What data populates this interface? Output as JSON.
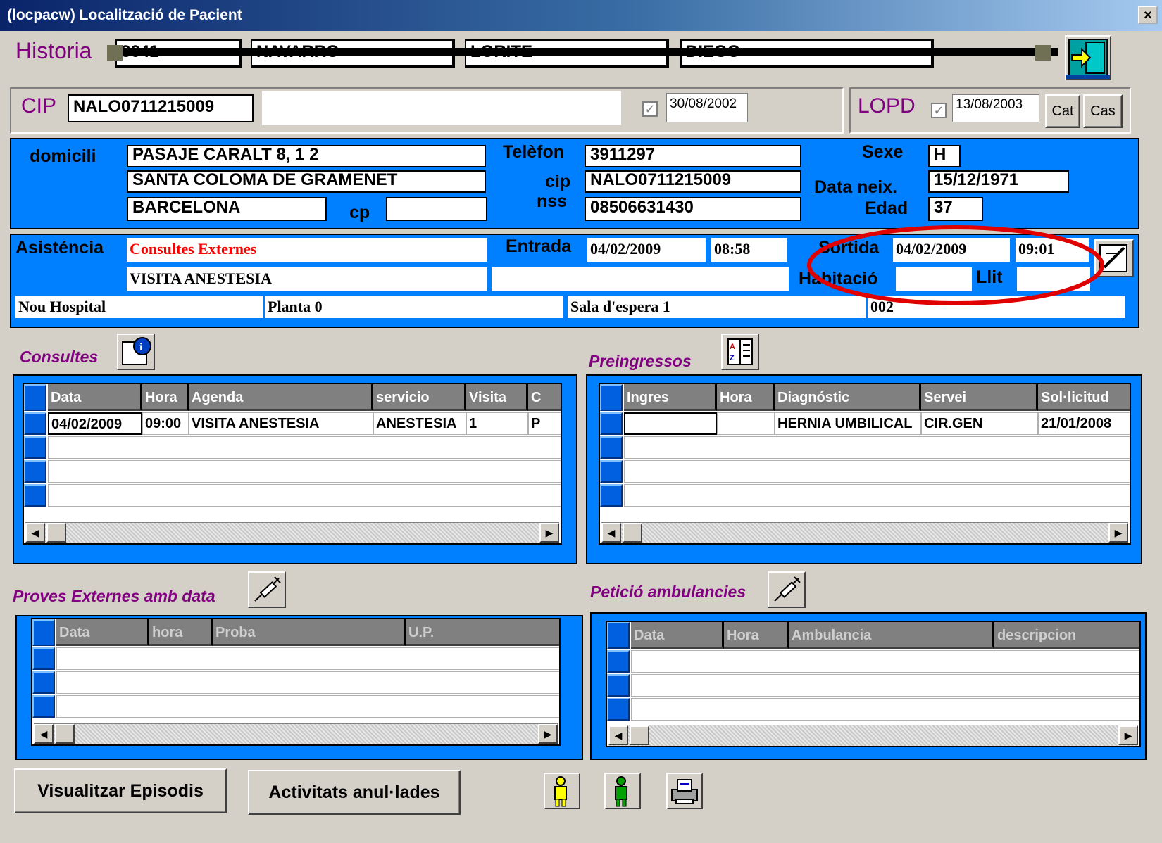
{
  "window": {
    "title": "(locpacw) Localització de Pacient",
    "close_glyph": "×"
  },
  "historia": {
    "label": "Historia",
    "fields": [
      "3641",
      "NAVARRO",
      "LORITE",
      "DIEGO"
    ]
  },
  "cip": {
    "label": "CIP",
    "value": "NALO0711215009",
    "check_date": "30/08/2002"
  },
  "lopd": {
    "label": "LOPD",
    "date": "13/08/2003",
    "cat": "Cat",
    "cas": "Cas"
  },
  "patient": {
    "domicili_label": "domicili",
    "addr1": "PASAJE CARALT 8, 1 2",
    "addr2": "SANTA COLOMA DE GRAMENET",
    "addr3": "BARCELONA",
    "cp_label": "cp",
    "cp_value": "",
    "telefon_label": "Telèfon",
    "telefon": "3911297",
    "cip_label": "cip",
    "cip": "NALO0711215009",
    "nss_label": "nss",
    "nss": "08506631430",
    "sexe_label": "Sexe",
    "sexe": "H",
    "dataneix_label": "Data neix.",
    "dataneix": "15/12/1971",
    "edad_label": "Edad",
    "edad": "37"
  },
  "asistencia": {
    "label": "Asisténcia",
    "type": "Consultes Externes",
    "sub": "VISITA ANESTESIA",
    "extra": "",
    "entrada_label": "Entrada",
    "entrada_date": "04/02/2009",
    "entrada_time": "08:58",
    "sortida_label": "Sortida",
    "sortida_date": "04/02/2009",
    "sortida_time": "09:01",
    "habitacio_label": "Habitació",
    "habitacio": "",
    "llit_label": "Llit",
    "llit": "",
    "loc1": "Nou Hospital",
    "loc2": "Planta 0",
    "loc3": "Sala d'espera 1",
    "loc4": "002"
  },
  "consultes": {
    "title": "Consultes",
    "headers": [
      "Data",
      "Hora",
      "Agenda",
      "servicio",
      "Visita",
      "C"
    ],
    "row": [
      "04/02/2009",
      "09:00",
      "VISITA ANESTESIA",
      "ANESTESIA",
      "1",
      "P"
    ]
  },
  "preingressos": {
    "title": "Preingressos",
    "headers": [
      "Ingres",
      "Hora",
      "Diagnóstic",
      "Servei",
      "Sol·licitud"
    ],
    "row": [
      "",
      "",
      "HERNIA UMBILICAL",
      "CIR.GEN",
      "21/01/2008"
    ]
  },
  "proves": {
    "title": "Proves Externes amb data",
    "headers": [
      "Data",
      "hora",
      "Proba",
      "U.P."
    ]
  },
  "ambulancies": {
    "title": "Petició ambulancies",
    "headers": [
      "Data",
      "Hora",
      "Ambulancia",
      "descripcion"
    ]
  },
  "buttons": {
    "episodis": "Visualitzar Episodis",
    "anulades": "Activitats anul·lades"
  },
  "icons": [
    "exit-door-icon",
    "edit-pen-icon",
    "info-document-icon",
    "sorted-list-icon",
    "syringe-icon",
    "person-yellow-icon",
    "person-green-icon",
    "printer-icon"
  ],
  "colors": {
    "panel_blue": "#0080ff",
    "label_purple": "#800080",
    "highlight_red": "#e00000"
  }
}
